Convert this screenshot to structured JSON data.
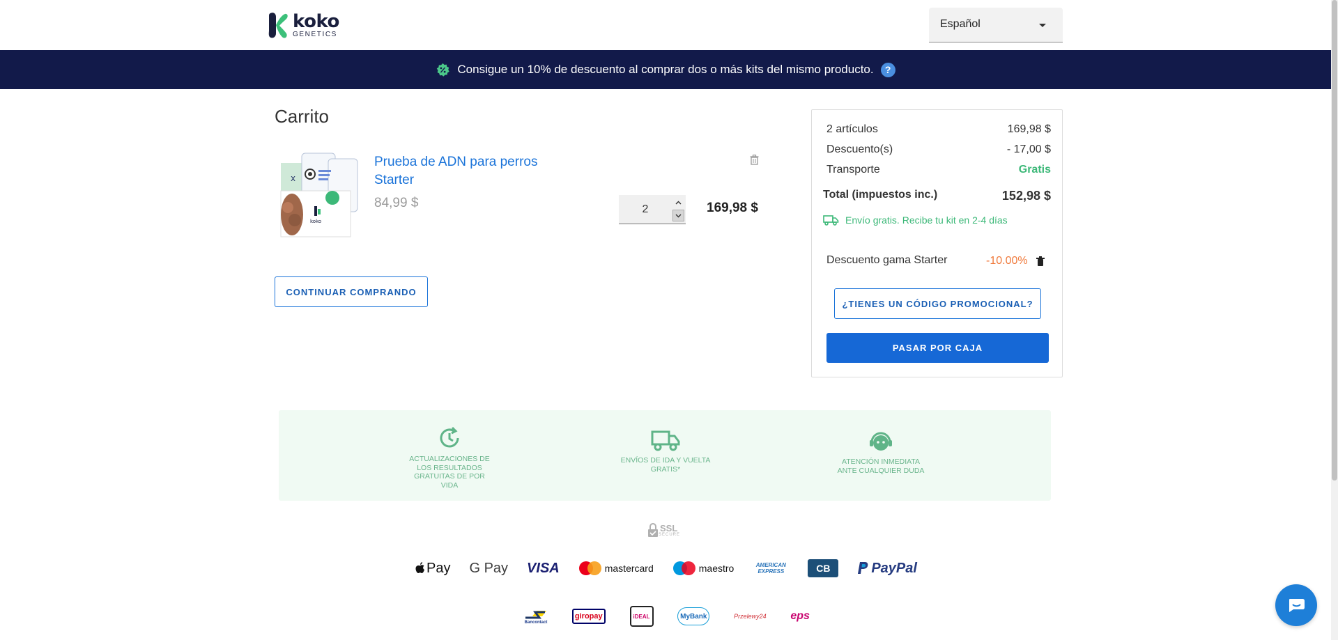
{
  "header": {
    "logo_name": "koko",
    "logo_sub": "GENETICS",
    "language": "Español"
  },
  "banner": {
    "text": "Consigue un 10% de descuento al comprar dos o más kits del mismo producto.",
    "help": "?"
  },
  "cart": {
    "title": "Carrito",
    "item": {
      "name": "Prueba de ADN para perros Starter",
      "unit_price": "84,99 $",
      "quantity": "2",
      "line_total": "169,98 $"
    },
    "continue_label": "CONTINUAR COMPRANDO"
  },
  "summary": {
    "items_label": "2 artículos",
    "items_value": "169,98 $",
    "discount_label": "Descuento(s)",
    "discount_value": "- 17,00 $",
    "shipping_label": "Transporte",
    "shipping_value": "Gratis",
    "total_label": "Total (impuestos inc.)",
    "total_value": "152,98 $",
    "shipping_note": "Envío gratis. Recibe tu kit en 2-4 días",
    "voucher_label": "Descuento gama Starter",
    "voucher_value": "-10.00%",
    "promo_label": "¿TIENES UN CÓDIGO PROMOCIONAL?",
    "checkout_label": "PASAR POR CAJA"
  },
  "benefits": [
    {
      "label": "ACTUALIZACIONES DE LOS RESULTADOS GRATUITAS DE POR VIDA",
      "icon": "clock-refresh-icon"
    },
    {
      "label": "ENVÍOS DE IDA Y VUELTA GRATIS*",
      "icon": "truck-icon"
    },
    {
      "label": "ATENCIÓN INMEDIATA ANTE CUALQUIER DUDA",
      "icon": "support-agent-icon"
    }
  ],
  "payments": {
    "ssl": "SSL",
    "ssl_sub": "SECURE",
    "row1": [
      "Pay",
      "G Pay",
      "VISA",
      "mastercard",
      "maestro",
      "AMERICAN EXPRESS",
      "CB",
      "PayPal"
    ],
    "row2": [
      "Bancontact",
      "giropay",
      "iDEAL",
      "MyBank",
      "Przelewy24",
      "eps"
    ]
  },
  "colors": {
    "brand_blue": "#1a73d9",
    "banner_bg": "#121a4a",
    "green": "#3cb878",
    "orange": "#f07a3c"
  }
}
